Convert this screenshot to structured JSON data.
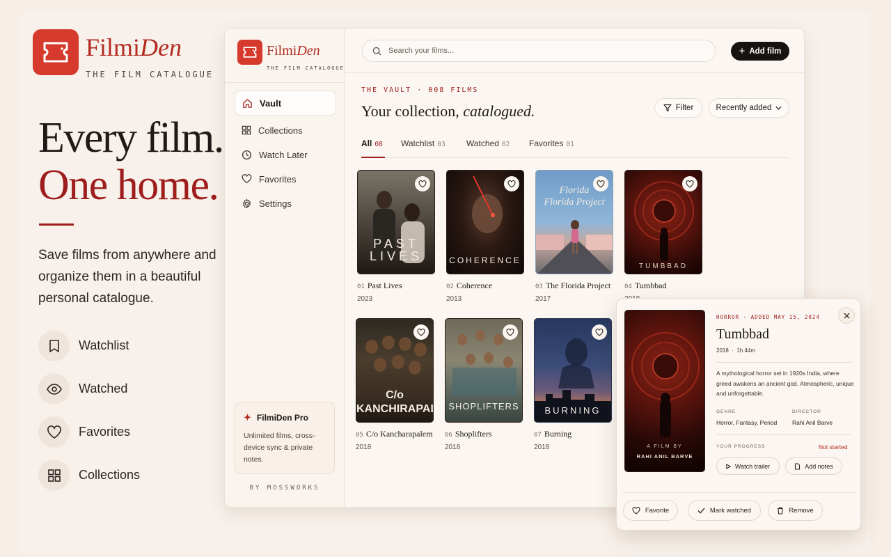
{
  "brand": {
    "name_a": "Filmi",
    "name_b": "Den",
    "tagline": "THE FILM CATALOGUE"
  },
  "hero": {
    "line1": "Every film.",
    "line2": "One home.",
    "description": "Save films from anywhere and organize them in a beautiful personal catalogue."
  },
  "features": [
    {
      "icon": "bookmark-icon",
      "label": "Watchlist"
    },
    {
      "icon": "eye-icon",
      "label": "Watched"
    },
    {
      "icon": "heart-icon",
      "label": "Favorites"
    },
    {
      "icon": "grid-icon",
      "label": "Collections"
    }
  ],
  "sidebar": {
    "logo_a": "Filmi",
    "logo_b": "Den",
    "logo_tag": "THE FILM CATALOGUE",
    "items": [
      {
        "icon": "home-icon",
        "label": "Vault"
      },
      {
        "icon": "grid-icon",
        "label": "Collections"
      },
      {
        "icon": "clock-icon",
        "label": "Watch Later"
      },
      {
        "icon": "heart-icon",
        "label": "Favorites"
      },
      {
        "icon": "gear-icon",
        "label": "Settings"
      }
    ],
    "pro_title": "FilmiDen Pro",
    "pro_desc": "Unlimited films, cross-device sync & private notes.",
    "byline": "BY MOSSWORKS"
  },
  "topbar": {
    "search_placeholder": "Search your films...",
    "add_label": "Add film"
  },
  "main": {
    "eyebrow": "THE VAULT · 008 FILMS",
    "title_a": "Your collection, ",
    "title_b": "catalogued.",
    "filter_label": "Filter",
    "sort_label": "Recently added",
    "tabs": [
      {
        "label": "All",
        "count": "08"
      },
      {
        "label": "Watchlist",
        "count": "03"
      },
      {
        "label": "Watched",
        "count": "02"
      },
      {
        "label": "Favorites",
        "count": "01"
      }
    ],
    "films": [
      {
        "num": "01",
        "title": "Past Lives",
        "year": "2023",
        "poster_text": "PAST\nLIVES"
      },
      {
        "num": "02",
        "title": "Coherence",
        "year": "2013",
        "poster_text": "COHERENCE"
      },
      {
        "num": "03",
        "title": "The Florida Project",
        "year": "2017",
        "poster_text": "Florida\nFlorida Project"
      },
      {
        "num": "04",
        "title": "Tumbbad",
        "year": "2018",
        "poster_text": "TUMBBAD"
      },
      {
        "num": "05",
        "title": "C/o Kancharapalem",
        "year": "2018",
        "poster_text": "C/o\nKANCHIRAPALEM"
      },
      {
        "num": "06",
        "title": "Shoplifters",
        "year": "2018",
        "poster_text": "SHOPLIFTERS"
      },
      {
        "num": "07",
        "title": "Burning",
        "year": "2018",
        "poster_text": "BURNING"
      }
    ]
  },
  "detail": {
    "eyebrow": "HORROR · ADDED MAY 15, 2024",
    "title": "Tumbbad",
    "year": "2018",
    "runtime": "1h 44m",
    "description": "A mythological horror set in 1920s India, where greed awakens an ancient god. Atmospheric, unique and unforgettable.",
    "genre_label": "GENRE",
    "genre": "Horror, Fantasy, Period",
    "director_label": "DIRECTOR",
    "director": "Rahi Anil Barve",
    "progress_label": "YOUR PROGRESS",
    "progress_status": "Not started",
    "trailer_label": "Watch trailer",
    "notes_label": "Add notes",
    "poster_line1": "A FILM BY",
    "poster_line2": "RAHI ANIL BARVE",
    "favorite_label": "Favorite",
    "watched_label": "Mark watched",
    "remove_label": "Remove"
  },
  "colors": {
    "accent": "#9e1e1e",
    "brand": "#d63a2d",
    "background": "#f6eee7"
  }
}
